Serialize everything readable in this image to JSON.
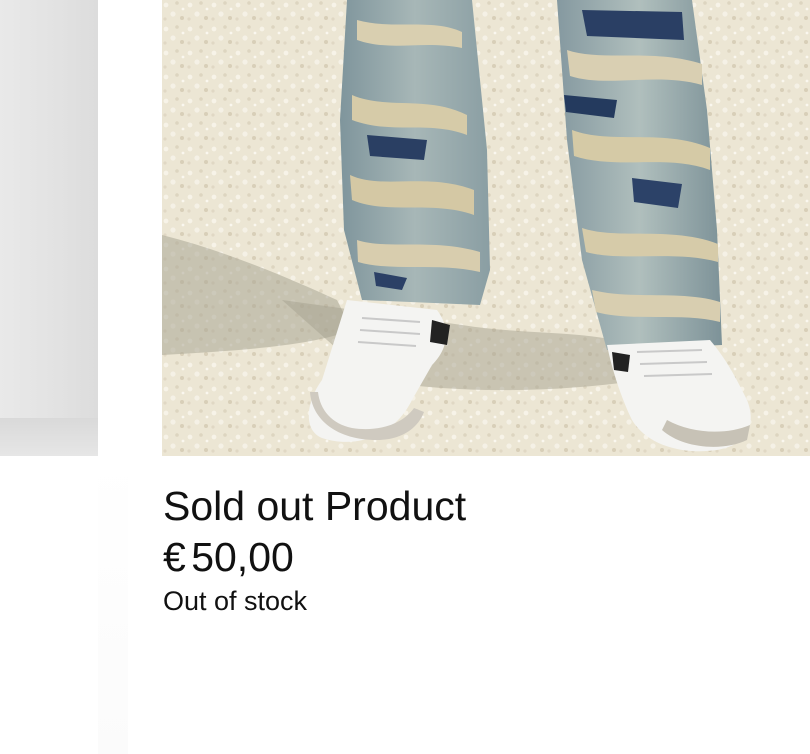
{
  "product": {
    "title": "Sold out Product",
    "price": "€ 50,00",
    "stock_status": "Out of stock",
    "image_alt": "distressed jeans and white sneakers on gravel"
  },
  "colors": {
    "background": "#ffffff",
    "text": "#111111",
    "gravel": "#e8e2cf",
    "denim": "#8fa3a8",
    "sneaker": "#f4f4f2"
  }
}
